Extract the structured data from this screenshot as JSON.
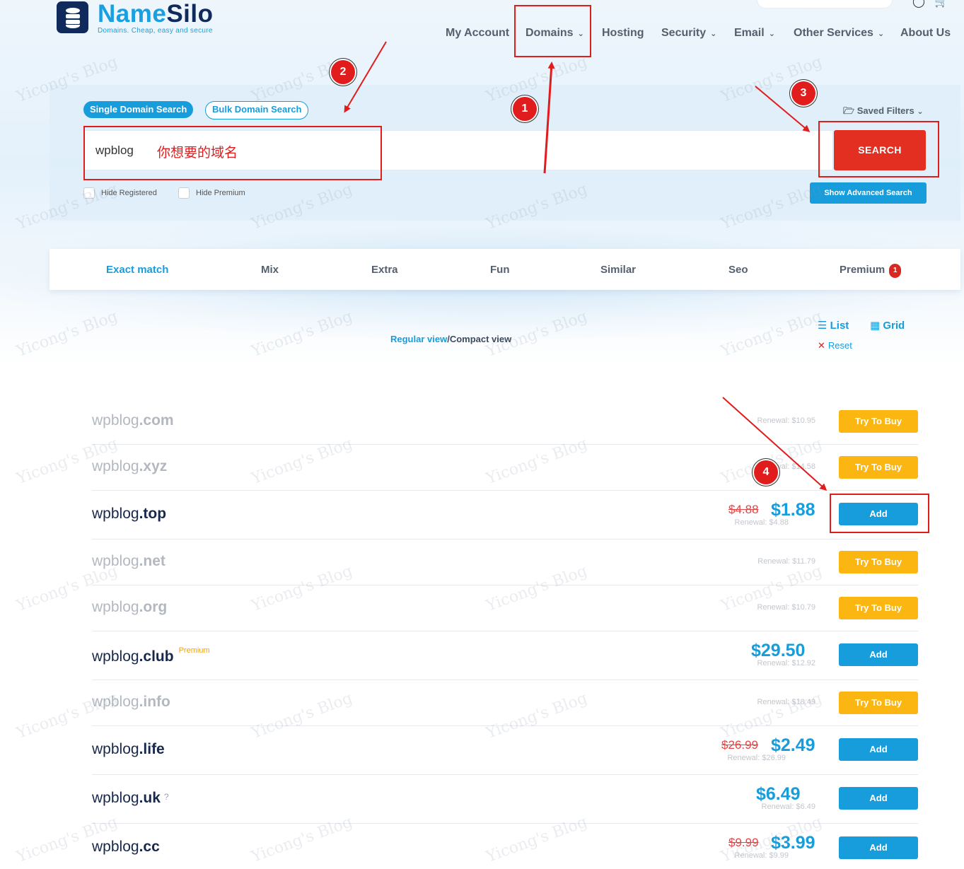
{
  "brand": {
    "name_part1": "Name",
    "name_part2": "Silo",
    "tagline": "Domains. Cheap, easy and secure"
  },
  "nav": [
    {
      "label": "My Account",
      "dropdown": false
    },
    {
      "label": "Domains",
      "dropdown": true
    },
    {
      "label": "Hosting",
      "dropdown": false
    },
    {
      "label": "Security",
      "dropdown": true
    },
    {
      "label": "Email",
      "dropdown": true
    },
    {
      "label": "Other Services",
      "dropdown": true
    },
    {
      "label": "About Us",
      "dropdown": false
    }
  ],
  "search": {
    "mode_single": "Single Domain Search",
    "mode_bulk": "Bulk Domain Search",
    "saved_filters": "Saved Filters",
    "value": "wpblog",
    "hint": "你想要的域名",
    "button": "SEARCH",
    "hide_registered": "Hide Registered",
    "hide_premium": "Hide Premium",
    "advanced": "Show Advanced Search"
  },
  "tabs": [
    "Exact match",
    "Mix",
    "Extra",
    "Fun",
    "Similar",
    "Seo",
    "Premium"
  ],
  "premium_count": "1",
  "views": {
    "regular": "Regular view",
    "separator": "/",
    "compact": "Compact view"
  },
  "layout_toggle": {
    "list": "List",
    "grid": "Grid",
    "reset": "Reset"
  },
  "results": [
    {
      "sld": "wpblog",
      "tld": ".com",
      "available": false,
      "renewal": "Renewal: $10.95",
      "button": "Try To Buy"
    },
    {
      "sld": "wpblog",
      "tld": ".xyz",
      "available": false,
      "renewal": "Renewal: $14.58",
      "button": "Try To Buy"
    },
    {
      "sld": "wpblog",
      "tld": ".top",
      "available": true,
      "old_price": "$4.88",
      "price": "$1.88",
      "renewal": "Renewal: $4.88",
      "button": "Add"
    },
    {
      "sld": "wpblog",
      "tld": ".net",
      "available": false,
      "renewal": "Renewal: $11.79",
      "button": "Try To Buy"
    },
    {
      "sld": "wpblog",
      "tld": ".org",
      "available": false,
      "renewal": "Renewal: $10.79",
      "button": "Try To Buy"
    },
    {
      "sld": "wpblog",
      "tld": ".club",
      "available": true,
      "tag": "Premium",
      "price": "$29.50",
      "renewal": "Renewal: $12.92",
      "button": "Add"
    },
    {
      "sld": "wpblog",
      "tld": ".info",
      "available": false,
      "renewal": "Renewal: $18.49",
      "button": "Try To Buy"
    },
    {
      "sld": "wpblog",
      "tld": ".life",
      "available": true,
      "old_price": "$26.99",
      "price": "$2.49",
      "renewal": "Renewal: $26.99",
      "button": "Add"
    },
    {
      "sld": "wpblog",
      "tld": ".uk",
      "available": true,
      "help": "?",
      "price": "$6.49",
      "renewal": "Renewal: $6.49",
      "button": "Add"
    },
    {
      "sld": "wpblog",
      "tld": ".cc",
      "available": true,
      "old_price": "$9.99",
      "price": "$3.99",
      "renewal": "Renewal: $9.99",
      "button": "Add"
    }
  ],
  "annotations": [
    "1",
    "2",
    "3",
    "4"
  ],
  "watermark": "Yicong's Blog",
  "colors": {
    "accent": "#179ddc",
    "navy": "#102a5c",
    "search_red": "#e22f21",
    "try_orange": "#fbb611",
    "annotation_red": "#e11c1c"
  }
}
